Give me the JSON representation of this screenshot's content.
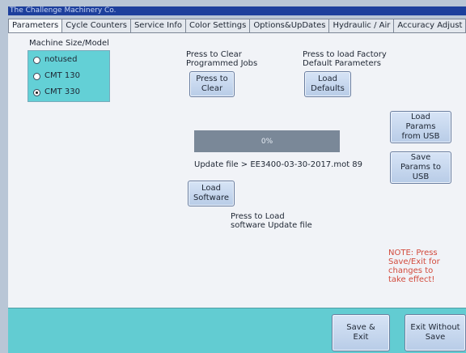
{
  "title": "The Challenge Machinery Co.",
  "tabs": [
    {
      "label": "Parameters",
      "active": true
    },
    {
      "label": "Cycle Counters",
      "active": false
    },
    {
      "label": "Service Info",
      "active": false
    },
    {
      "label": "Color Settings",
      "active": false
    },
    {
      "label": "Options&UpDates",
      "active": false
    },
    {
      "label": "Hydraulic / Air",
      "active": false
    },
    {
      "label": "Accuracy Adjust",
      "active": false
    }
  ],
  "machine": {
    "label": "Machine Size/Model",
    "options": [
      {
        "label": "notused",
        "checked": false
      },
      {
        "label": "CMT 130",
        "checked": false
      },
      {
        "label": "CMT 330",
        "checked": true
      }
    ]
  },
  "clear_programmed": {
    "description": "Press to Clear Programmed Jobs",
    "button_label": "Press to Clear"
  },
  "factory_defaults": {
    "description": "Press to load Factory Default Parameters",
    "button_label": "Load Defaults"
  },
  "usb": {
    "load_label": "Load Params from USB",
    "save_label": "Save Params to USB"
  },
  "progress": {
    "text": "0%",
    "value": 0
  },
  "update_file": "Update file > EE3400-03-30-2017.mot 89",
  "software": {
    "button_label": "Load Software",
    "description": "Press to Load software Update file"
  },
  "note": "NOTE: Press Save/Exit for changes to take effect!",
  "footer": {
    "save_exit_label": "Save & Exit",
    "exit_without_save_label": "Exit Without Save"
  },
  "colors": {
    "title_bar": "#1d3f9c",
    "panel": "#f1f3f7",
    "accent_cyan": "#63d0d6",
    "button": "#c7d8ef",
    "progress_bg": "#7a8898",
    "note": "#d24a3c"
  }
}
